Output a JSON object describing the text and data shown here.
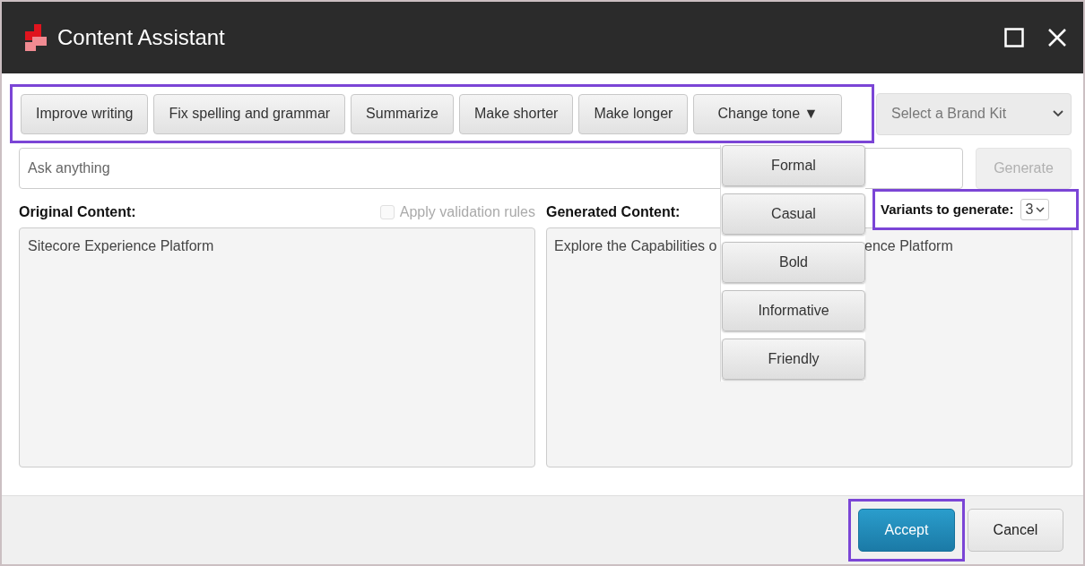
{
  "window": {
    "title": "Content Assistant"
  },
  "toolbar": {
    "highlighted": true,
    "actions": [
      {
        "label": "Improve writing"
      },
      {
        "label": "Fix spelling and grammar"
      },
      {
        "label": "Summarize"
      },
      {
        "label": "Make shorter"
      },
      {
        "label": "Make longer"
      }
    ],
    "tone": {
      "label": "Change tone",
      "caret": "▼",
      "expanded": true,
      "items": [
        {
          "label": "Formal"
        },
        {
          "label": "Casual"
        },
        {
          "label": "Bold"
        },
        {
          "label": "Informative"
        },
        {
          "label": "Friendly"
        }
      ]
    }
  },
  "brand_kit": {
    "placeholder": "Select a Brand Kit"
  },
  "ask": {
    "placeholder": "Ask anything"
  },
  "generate": {
    "label": "Generate",
    "disabled": true
  },
  "original": {
    "label": "Original Content:",
    "text": "Sitecore Experience Platform"
  },
  "validation": {
    "label": "Apply validation rules",
    "checked": false,
    "disabled": true
  },
  "generated": {
    "label": "Generated Content:",
    "text_parts": [
      "Explore the Capabilities o",
      "ence Platform"
    ]
  },
  "variants": {
    "label": "Variants to generate:",
    "value": "3",
    "highlighted": true
  },
  "footer": {
    "buttons": [
      {
        "label": "Accept",
        "kind": "primary",
        "highlighted": true
      },
      {
        "label": "Cancel",
        "kind": "secondary",
        "highlighted": false
      }
    ]
  }
}
